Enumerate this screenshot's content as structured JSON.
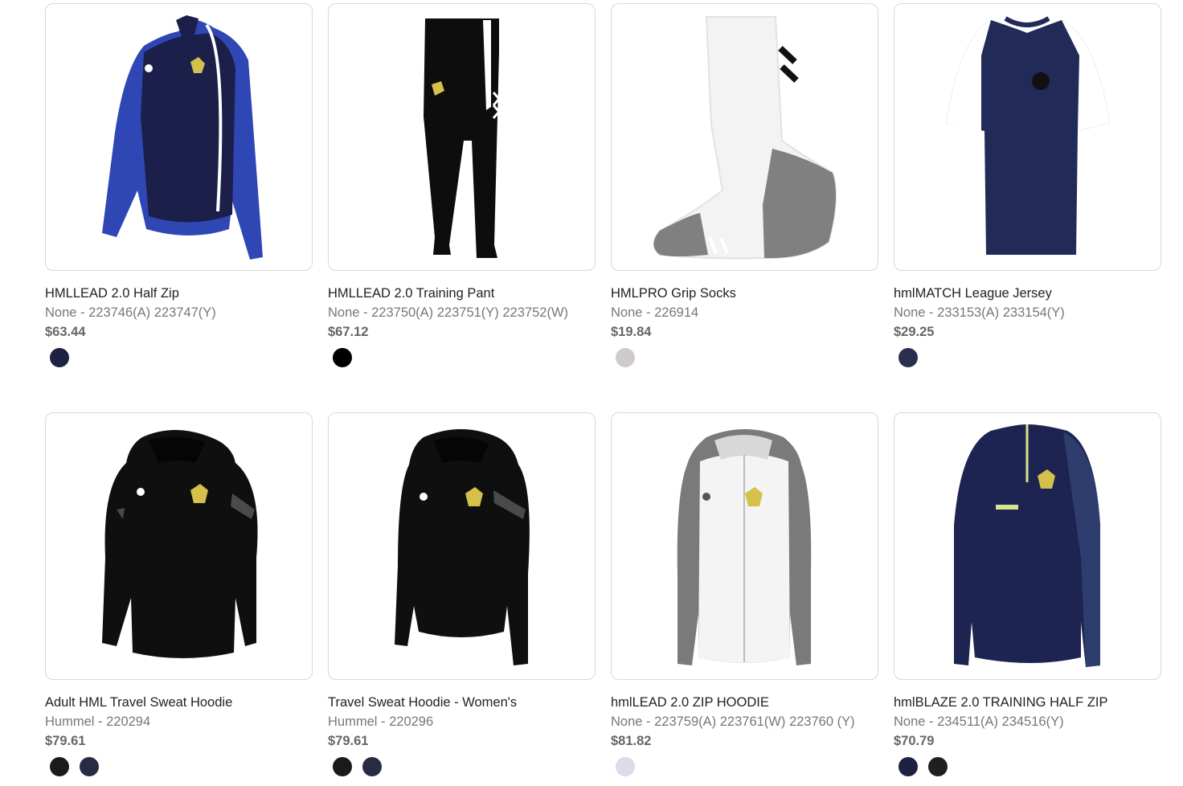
{
  "products": [
    {
      "name": "HMLLEAD 2.0 Half Zip",
      "sku": "None - 223746(A) 223747(Y)",
      "price": "$63.44",
      "image": "navy-royal-half-zip-top",
      "colors": [
        "#1d2142"
      ]
    },
    {
      "name": "HMLLEAD 2.0 Training Pant",
      "sku": "None - 223750(A) 223751(Y) 223752(W)",
      "price": "$67.12",
      "image": "black-training-pant",
      "colors": [
        "#000000"
      ]
    },
    {
      "name": "HMLPRO Grip Socks",
      "sku": "None - 226914",
      "price": "$19.84",
      "image": "white-grip-sock",
      "colors": [
        "#cfcbcd"
      ]
    },
    {
      "name": "hmlMATCH League Jersey",
      "sku": "None - 233153(A) 233154(Y)",
      "price": "$29.25",
      "image": "navy-white-jersey",
      "colors": [
        "#2a2f4f"
      ]
    },
    {
      "name": "Adult HML Travel Sweat Hoodie",
      "sku": "Hummel - 220294",
      "price": "$79.61",
      "image": "black-hoodie",
      "colors": [
        "#1a1a1a",
        "#272c44"
      ]
    },
    {
      "name": "Travel Sweat Hoodie - Women's",
      "sku": "Hummel - 220296",
      "price": "$79.61",
      "image": "black-womens-hoodie",
      "colors": [
        "#1a1a1a",
        "#272c44"
      ]
    },
    {
      "name": "hmlLEAD 2.0 ZIP HOODIE",
      "sku": "None - 223759(A) 223761(W) 223760 (Y)",
      "price": "$81.82",
      "image": "white-grey-zip-hoodie",
      "colors": [
        "#dcdbe6"
      ]
    },
    {
      "name": "hmlBLAZE 2.0 TRAINING HALF ZIP",
      "sku": "None - 234511(A) 234516(Y)",
      "price": "$70.79",
      "image": "navy-blaze-half-zip",
      "colors": [
        "#1d2142",
        "#1f1f1f"
      ]
    }
  ]
}
